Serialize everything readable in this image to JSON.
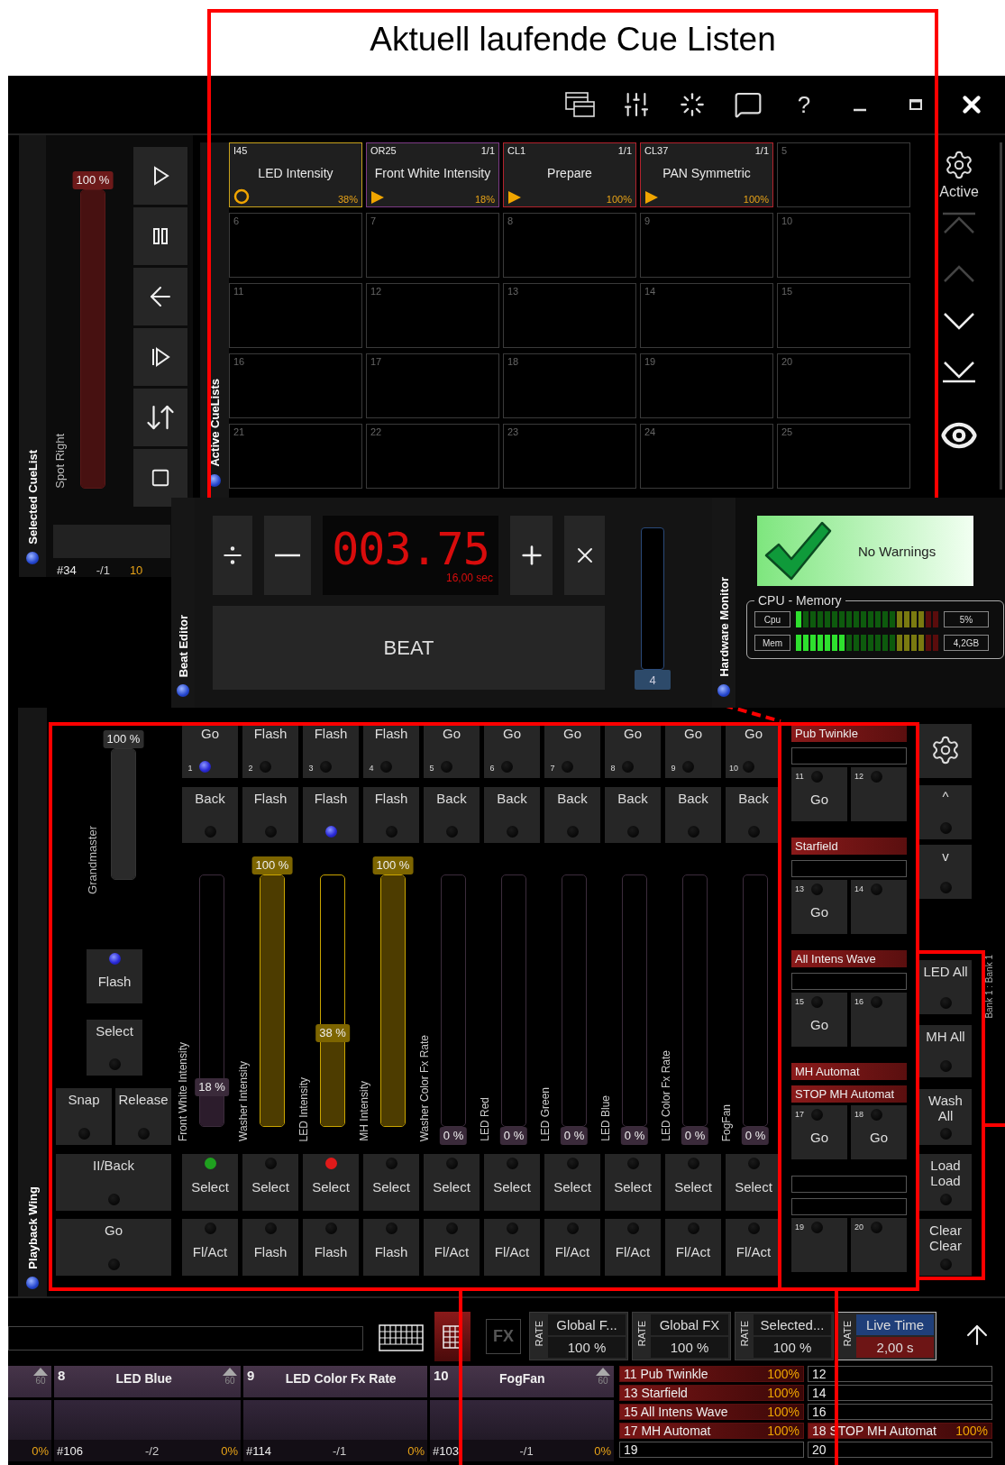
{
  "annotation": {
    "title": "Aktuell laufende Cue Listen"
  },
  "title_bar": {
    "help": "?"
  },
  "selected_cuelist": {
    "panel_title": "Selected CueList",
    "fader_reading": "100 %",
    "level": 1,
    "name": "Spot Right",
    "number": "#34",
    "step": "-/1",
    "value": "10"
  },
  "active_cuelists": {
    "panel_title": "Active CueLists",
    "active_label": "Active",
    "cells": [
      {
        "kind": "cue",
        "slot": "I45",
        "name": "LED Intensity",
        "percent": "38%",
        "running": false,
        "color": "#c9a21c"
      },
      {
        "kind": "cue",
        "slot": "OR25",
        "count": "1/1",
        "name": "Front White Intensity",
        "percent": "18%",
        "running": true,
        "color": "#7d3a86"
      },
      {
        "kind": "cue",
        "slot": "CL1",
        "count": "1/1",
        "name": "Prepare",
        "percent": "100%",
        "running": true,
        "color": "#b3222c"
      },
      {
        "kind": "cue",
        "slot": "CL37",
        "count": "1/1",
        "name": "PAN Symmetric",
        "percent": "100%",
        "running": true,
        "color": "#b3222c"
      },
      {
        "kind": "empty",
        "slot": "5"
      },
      {
        "kind": "empty",
        "slot": "6"
      },
      {
        "kind": "empty",
        "slot": "7"
      },
      {
        "kind": "empty",
        "slot": "8"
      },
      {
        "kind": "empty",
        "slot": "9"
      },
      {
        "kind": "empty",
        "slot": "10"
      },
      {
        "kind": "empty",
        "slot": "11"
      },
      {
        "kind": "empty",
        "slot": "12"
      },
      {
        "kind": "empty",
        "slot": "13"
      },
      {
        "kind": "empty",
        "slot": "14"
      },
      {
        "kind": "empty",
        "slot": "15"
      },
      {
        "kind": "empty",
        "slot": "16"
      },
      {
        "kind": "empty",
        "slot": "17"
      },
      {
        "kind": "empty",
        "slot": "18"
      },
      {
        "kind": "empty",
        "slot": "19"
      },
      {
        "kind": "empty",
        "slot": "20"
      },
      {
        "kind": "empty",
        "slot": "21"
      },
      {
        "kind": "empty",
        "slot": "22"
      },
      {
        "kind": "empty",
        "slot": "23"
      },
      {
        "kind": "empty",
        "slot": "24"
      },
      {
        "kind": "empty",
        "slot": "25"
      }
    ]
  },
  "beat_editor": {
    "panel_title": "Beat Editor",
    "display": "003.75",
    "duration": "16,00 sec",
    "beat_button": "BEAT",
    "slider_value": "4"
  },
  "hardware_monitor": {
    "panel_title": "Hardware Monitor",
    "status": "No Warnings",
    "group_title": "CPU - Memory",
    "meters": [
      {
        "label": "Cpu",
        "level": 0.05,
        "reading": "5%"
      },
      {
        "label": "Mem",
        "level": 0.35,
        "reading": "4,2GB"
      }
    ]
  },
  "playback_wing": {
    "panel_title": "Playback Wing",
    "grandmaster": {
      "reading": "100 %",
      "label": "Grandmaster",
      "level": 1
    },
    "left_buttons": [
      {
        "kind": "top_led",
        "label": "Flash",
        "led_on": true
      },
      {
        "kind": "bottom_led",
        "label": "Select",
        "led_on": false
      },
      {
        "kind": "bottom_led",
        "label": "Snap",
        "led_on": false
      },
      {
        "kind": "bottom_led",
        "label": "Release",
        "led_on": false
      },
      {
        "kind": "bottom_led",
        "label": "II/Back",
        "led_on": false
      },
      {
        "kind": "bottom_led",
        "label": "Go",
        "led_on": false
      }
    ],
    "faders": [
      {
        "number": "1",
        "top": {
          "label": "Go",
          "led_on": true
        },
        "second": {
          "label": "Back",
          "led_on": false
        },
        "name": "Front White Intensity",
        "reading": "18 %",
        "level": 0.18,
        "active": false,
        "select_label": "Select",
        "select_led": {
          "on": true,
          "color": "#1fa01f"
        },
        "bottom_label": "Fl/Act"
      },
      {
        "number": "2",
        "top": {
          "label": "Flash",
          "led_on": false
        },
        "second": {
          "label": "Flash",
          "led_on": false
        },
        "name": "Washer Intensity",
        "reading": "100 %",
        "level": 1,
        "active": true,
        "select_label": "Select",
        "select_led": {
          "on": false
        },
        "bottom_label": "Flash"
      },
      {
        "number": "3",
        "top": {
          "label": "Flash",
          "led_on": false
        },
        "second": {
          "label": "Flash",
          "led_on": true
        },
        "name": "LED Intensity",
        "reading": "38 %",
        "level": 0.38,
        "active": true,
        "select_label": "Select",
        "select_led": {
          "on": true,
          "color": "#e01a1a"
        },
        "bottom_label": "Flash"
      },
      {
        "number": "4",
        "top": {
          "label": "Flash",
          "led_on": false
        },
        "second": {
          "label": "Flash",
          "led_on": false
        },
        "name": "MH Intensity",
        "reading": "100 %",
        "level": 1,
        "active": true,
        "select_label": "Select",
        "select_led": {
          "on": false
        },
        "bottom_label": "Flash"
      },
      {
        "number": "5",
        "top": {
          "label": "Go",
          "led_on": false
        },
        "second": {
          "label": "Back",
          "led_on": false
        },
        "name": "Washer Color Fx Rate",
        "reading": "0 %",
        "level": 0,
        "active": false,
        "select_label": "Select",
        "select_led": {
          "on": false
        },
        "bottom_label": "Fl/Act"
      },
      {
        "number": "6",
        "top": {
          "label": "Go",
          "led_on": false
        },
        "second": {
          "label": "Back",
          "led_on": false
        },
        "name": "LED Red",
        "reading": "0 %",
        "level": 0,
        "active": false,
        "select_label": "Select",
        "select_led": {
          "on": false
        },
        "bottom_label": "Fl/Act"
      },
      {
        "number": "7",
        "top": {
          "label": "Go",
          "led_on": false
        },
        "second": {
          "label": "Back",
          "led_on": false
        },
        "name": "LED Green",
        "reading": "0 %",
        "level": 0,
        "active": false,
        "select_label": "Select",
        "select_led": {
          "on": false
        },
        "bottom_label": "Fl/Act"
      },
      {
        "number": "8",
        "top": {
          "label": "Go",
          "led_on": false
        },
        "second": {
          "label": "Back",
          "led_on": false
        },
        "name": "LED Blue",
        "reading": "0 %",
        "level": 0,
        "active": false,
        "select_label": "Select",
        "select_led": {
          "on": false
        },
        "bottom_label": "Fl/Act"
      },
      {
        "number": "9",
        "top": {
          "label": "Go",
          "led_on": false
        },
        "second": {
          "label": "Back",
          "led_on": false
        },
        "name": "LED Color Fx Rate",
        "reading": "0 %",
        "level": 0,
        "active": false,
        "select_label": "Select",
        "select_led": {
          "on": false
        },
        "bottom_label": "Fl/Act"
      },
      {
        "number": "10",
        "top": {
          "label": "Go",
          "led_on": false
        },
        "second": {
          "label": "Back",
          "led_on": false
        },
        "name": "FogFan",
        "reading": "0 %",
        "level": 0,
        "active": false,
        "select_label": "Select",
        "select_led": {
          "on": false
        },
        "bottom_label": "Fl/Act"
      }
    ],
    "groups": [
      {
        "labels": [
          "Pub Twinkle"
        ],
        "slots": [
          {
            "number": "11",
            "label": "Go"
          },
          {
            "number": "12"
          }
        ]
      },
      {
        "labels": [
          "Starfield"
        ],
        "slots": [
          {
            "number": "13",
            "label": "Go"
          },
          {
            "number": "14"
          }
        ]
      },
      {
        "labels": [
          "All Intens Wave"
        ],
        "slots": [
          {
            "number": "15",
            "label": "Go"
          },
          {
            "number": "16"
          }
        ]
      },
      {
        "labels": [
          "MH Automat",
          "STOP MH Automat"
        ],
        "slots": [
          {
            "number": "17",
            "label": "Go"
          },
          {
            "number": "18",
            "label": "Go"
          }
        ]
      },
      {
        "slots": [
          {
            "number": "19"
          },
          {
            "number": "20"
          }
        ]
      }
    ],
    "side": {
      "up": "^",
      "down": "v",
      "buttons": [
        "LED All",
        "MH All",
        "Wash All",
        "Load Load",
        "Clear Clear"
      ],
      "bank": "Bank 1 : Bank 1"
    }
  },
  "toolbar": {
    "grid_selected": true,
    "fx": "FX",
    "rates": [
      {
        "kind": "rate",
        "tag": "RATE",
        "label": "Global F...",
        "value": "100 %"
      },
      {
        "kind": "rate",
        "tag": "RATE",
        "label": "Global FX",
        "value": "100 %"
      },
      {
        "kind": "rate",
        "tag": "RATE",
        "label": "Selected...",
        "value": "100 %"
      },
      {
        "kind": "time",
        "tag": "RATE",
        "label": "Live Time",
        "value": "2,00 s"
      }
    ]
  },
  "playback_tiles": [
    {
      "kind": "partial",
      "max": "60",
      "percent": "0%"
    },
    {
      "kind": "full",
      "number": "8",
      "name": "LED Blue",
      "max": "60",
      "id": "#106",
      "step": "-/2",
      "percent": "0%"
    },
    {
      "kind": "full",
      "number": "9",
      "name": "LED Color Fx Rate",
      "id": "#114",
      "step": "-/1",
      "percent": "0%"
    },
    {
      "kind": "full",
      "number": "10",
      "name": "FogFan",
      "max": "60",
      "id": "#103",
      "step": "-/1",
      "percent": "0%"
    }
  ],
  "running_list": [
    {
      "label": "11 Pub Twinkle",
      "percent": "100%",
      "active": true
    },
    {
      "label": "12",
      "active": false
    },
    {
      "label": "13 Starfield",
      "percent": "100%",
      "active": true
    },
    {
      "label": "14",
      "active": false
    },
    {
      "label": "15 All Intens Wave",
      "percent": "100%",
      "active": true
    },
    {
      "label": "16",
      "active": false
    },
    {
      "label": "17 MH Automat",
      "percent": "100%",
      "active": true
    },
    {
      "label": "18 STOP MH Automat",
      "percent": "100%",
      "active": true
    },
    {
      "label": "19",
      "active": false
    },
    {
      "label": "20",
      "active": false
    }
  ]
}
